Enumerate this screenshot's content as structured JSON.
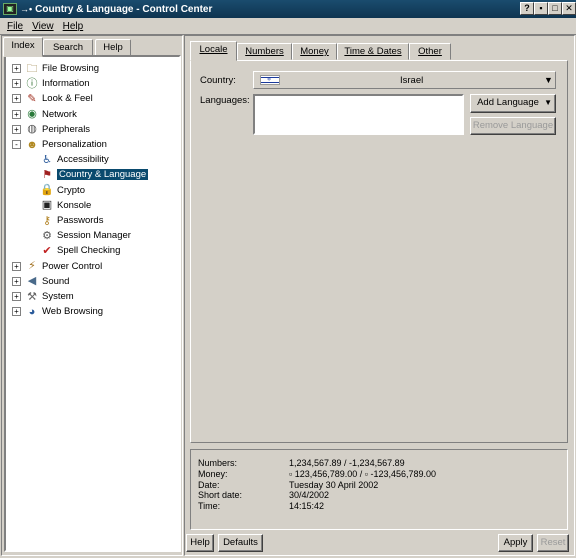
{
  "window": {
    "title": "Country & Language - Control Center",
    "controls": [
      "?",
      "▪",
      "□",
      "✕"
    ]
  },
  "menu": [
    "File",
    "View",
    "Help"
  ],
  "left_tabs": [
    "Index",
    "Search",
    "Help"
  ],
  "tree": [
    {
      "label": "File Browsing",
      "icon": "folder-icon",
      "expander": "+"
    },
    {
      "label": "Information",
      "icon": "info-icon",
      "expander": "+"
    },
    {
      "label": "Look & Feel",
      "icon": "paint-icon",
      "expander": "+"
    },
    {
      "label": "Network",
      "icon": "globe-icon",
      "expander": "+"
    },
    {
      "label": "Peripherals",
      "icon": "mouse-icon",
      "expander": "+"
    },
    {
      "label": "Personalization",
      "icon": "person-icon",
      "expander": "-"
    },
    {
      "label": "Accessibility",
      "icon": "accessibility-icon"
    },
    {
      "label": "Country & Language",
      "icon": "flag-icon",
      "selected": true
    },
    {
      "label": "Crypto",
      "icon": "lock-icon"
    },
    {
      "label": "Konsole",
      "icon": "terminal-icon"
    },
    {
      "label": "Passwords",
      "icon": "key-icon"
    },
    {
      "label": "Session Manager",
      "icon": "session-icon"
    },
    {
      "label": "Spell Checking",
      "icon": "spellcheck-icon"
    },
    {
      "label": "Power Control",
      "icon": "power-icon",
      "expander": "+"
    },
    {
      "label": "Sound",
      "icon": "speaker-icon",
      "expander": "+"
    },
    {
      "label": "System",
      "icon": "system-icon",
      "expander": "+"
    },
    {
      "label": "Web Browsing",
      "icon": "web-icon",
      "expander": "+"
    }
  ],
  "right_tabs": [
    "Locale",
    "Numbers",
    "Money",
    "Time & Dates",
    "Other"
  ],
  "locale": {
    "country_label": "Country:",
    "country_value": "Israel",
    "languages_label": "Languages:",
    "add_language": "Add Language",
    "remove_language": "Remove Language"
  },
  "preview": {
    "rows": [
      {
        "label": "Numbers:",
        "value": "1,234,567.89 / -1,234,567.89"
      },
      {
        "label": "Money:",
        "value": "▫ 123,456,789.00 / ▫ -123,456,789.00"
      },
      {
        "label": "Date:",
        "value": "Tuesday 30 April 2002"
      },
      {
        "label": "Short date:",
        "value": "30/4/2002"
      },
      {
        "label": "Time:",
        "value": "14:15:42"
      }
    ]
  },
  "buttons": {
    "help": "Help",
    "defaults": "Defaults",
    "apply": "Apply",
    "reset": "Reset"
  },
  "colors": {
    "titlebar": "#0e3450",
    "selection": "#0a4a6e",
    "face": "#d4d0c8"
  }
}
